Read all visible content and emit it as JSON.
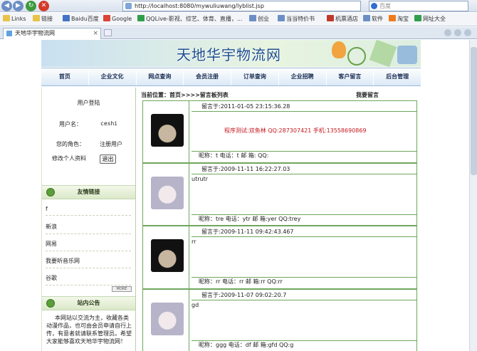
{
  "browser": {
    "url": "http://localhost:8080/mywuliuwang/lyblist.jsp",
    "search_placeholder": "百度",
    "bookmarks": [
      "Links",
      "链接",
      "Baidu百度",
      "Google",
      "QQLive-影视、综艺、体育、直播，...",
      "创业",
      "当当特价书",
      "机票酒店",
      "软件",
      "淘宝",
      "网址大全"
    ],
    "tab_title": "天地华宇物流网"
  },
  "site": {
    "title": "天地华宇物流网",
    "menu": [
      "首页",
      "企业文化",
      "网点查询",
      "会员注册",
      "订单查询",
      "企业招聘",
      "客户留言",
      "后台管理"
    ]
  },
  "location": "当前位置：首页>>>>留言板列表",
  "write_message": "我要留言",
  "sidebar": {
    "login_title": "用户登陆",
    "username_label": "用户名：",
    "username": "ceshi",
    "role_label": "您的角色：",
    "role": "注册用户",
    "edit_profile": "修改个人资料",
    "logout": "退出",
    "links_title": "友情链接",
    "links": [
      "f",
      "新浪",
      "网易",
      "我要听音乐网",
      "谷歌"
    ],
    "more": "MORE",
    "notice_title": "站内公告",
    "notice_text": "本网站以交流为主，收藏各类动漫作品，也可由会员申请自行上传，有意者就请联系管理员。希望大家能够喜欢天地华宇物流网！"
  },
  "messages": [
    {
      "time": "留言于:2011-01-05 23:15:36.28",
      "content": "程序测试:双鱼林 QQ:287307421 手机:13558690869",
      "footer": "昵称：t    电话：t  邮  箱:     QQ:"
    },
    {
      "time": "留言于:2009-11-11 16:22:27.03",
      "content": "utrutr",
      "footer": "昵称：tre    电话：ytr  邮 箱:yer    QQ:trey"
    },
    {
      "time": "留言于:2009-11-11 09:42:43.467",
      "content": "rr",
      "footer": "昵称：rr    电话：rr  邮 箱:rr    QQ:rr"
    },
    {
      "time": "留言于:2009-11-07 09:02:20.7",
      "content": "gd",
      "footer": "昵称：ggg    电话：df  邮 箱:gfd    QQ:g"
    }
  ]
}
